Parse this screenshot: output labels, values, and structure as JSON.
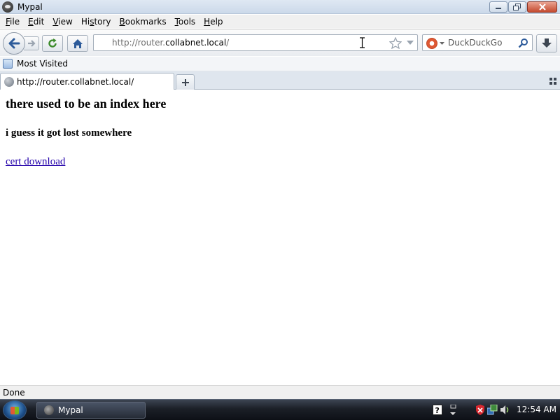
{
  "window": {
    "title": "Mypal"
  },
  "menu": [
    {
      "key": "F",
      "rest": "ile"
    },
    {
      "key": "E",
      "rest": "dit"
    },
    {
      "key": "V",
      "rest": "iew"
    },
    {
      "pre": "Hi",
      "key": "s",
      "rest": "tory"
    },
    {
      "key": "B",
      "rest": "ookmarks"
    },
    {
      "key": "T",
      "rest": "ools"
    },
    {
      "key": "H",
      "rest": "elp"
    }
  ],
  "urlbar": {
    "prefix": "http://router.",
    "host": "collabnet.local",
    "suffix": "/"
  },
  "search": {
    "placeholder": "DuckDuckGo"
  },
  "bookmarks": [
    {
      "label": "Most Visited"
    }
  ],
  "tabs": [
    {
      "label": "http://router.collabnet.local/"
    }
  ],
  "page": {
    "heading": "there used to be an index here",
    "subheading": "i guess it got lost somewhere",
    "link_text": "cert download"
  },
  "status": {
    "text": "Done"
  },
  "taskbar": {
    "task_label": "Mypal",
    "clock": "12:54 AM"
  }
}
